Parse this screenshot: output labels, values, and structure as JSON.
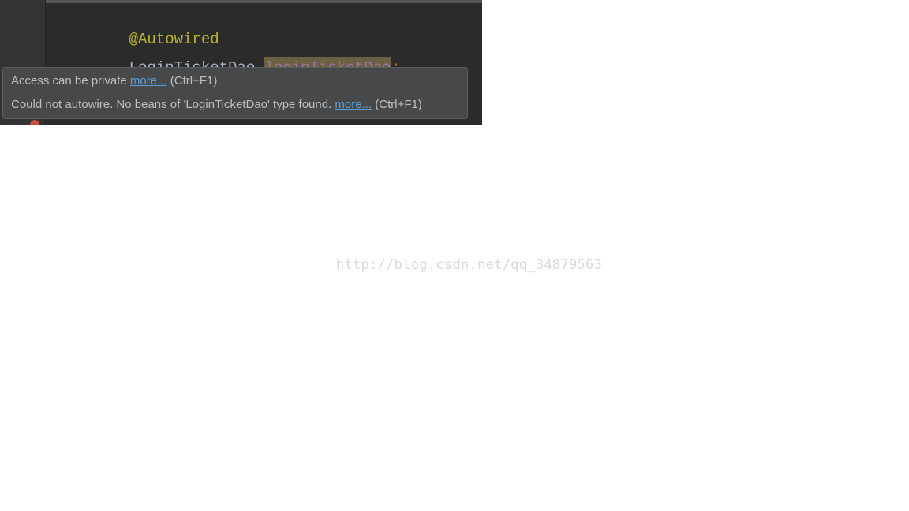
{
  "code": {
    "annotation": "@Autowired",
    "type": "LoginTicketDao",
    "field": "loginTicketDao",
    "semicolon": ";"
  },
  "inspection": {
    "msg1": "Access can be private ",
    "more1": "more...",
    "hint1": " (Ctrl+F1)",
    "msg2": "Could not autowire. No beans of 'LoginTicketDao' type found. ",
    "more2": "more...",
    "hint2": " (Ctrl+F1)"
  },
  "watermark": "http://blog.csdn.net/qq_34879563"
}
